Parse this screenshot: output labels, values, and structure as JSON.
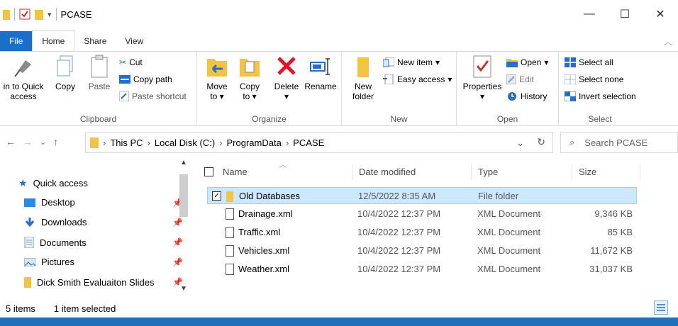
{
  "window": {
    "title": "PCASE",
    "minimize": "—",
    "maximize": "☐",
    "close": "✕"
  },
  "ribbon_tabs": [
    "File",
    "Home",
    "Share",
    "View"
  ],
  "ribbon": {
    "clipboard": {
      "label": "Clipboard",
      "pin_line1": "in to Quick",
      "pin_line2": "access",
      "copy": "Copy",
      "paste": "Paste",
      "cut": "Cut",
      "copy_path": "Copy path",
      "paste_shortcut": "Paste shortcut"
    },
    "organize": {
      "label": "Organize",
      "move_to_line1": "Move",
      "move_to_line2": "to",
      "copy_to_line1": "Copy",
      "copy_to_line2": "to",
      "delete": "Delete",
      "rename": "Rename"
    },
    "new": {
      "label": "New",
      "new_folder_line1": "New",
      "new_folder_line2": "folder",
      "new_item": "New item",
      "easy_access": "Easy access"
    },
    "open": {
      "label": "Open",
      "properties": "Properties",
      "open": "Open",
      "edit": "Edit",
      "history": "History"
    },
    "select": {
      "label": "Select",
      "select_all": "Select all",
      "select_none": "Select none",
      "invert_selection": "Invert selection"
    }
  },
  "address": {
    "crumbs": [
      "This PC",
      "Local Disk (C:)",
      "ProgramData",
      "PCASE"
    ],
    "search_placeholder": "Search PCASE"
  },
  "nav_pane": {
    "quick_access": "Quick access",
    "items": [
      {
        "label": "Desktop",
        "icon": "desktop-icon"
      },
      {
        "label": "Downloads",
        "icon": "download-arrow-icon"
      },
      {
        "label": "Documents",
        "icon": "document-icon"
      },
      {
        "label": "Pictures",
        "icon": "pictures-icon"
      },
      {
        "label": "Dick Smith Evaluaiton Slides",
        "icon": "folder-icon"
      }
    ]
  },
  "columns": {
    "name": "Name",
    "date": "Date modified",
    "type": "Type",
    "size": "Size"
  },
  "files": [
    {
      "name": "Old Databases",
      "date": "12/5/2022 8:35 AM",
      "type": "File folder",
      "size": "",
      "selected": true
    },
    {
      "name": "Drainage.xml",
      "date": "10/4/2022 12:37 PM",
      "type": "XML Document",
      "size": "9,346 KB"
    },
    {
      "name": "Traffic.xml",
      "date": "10/4/2022 12:37 PM",
      "type": "XML Document",
      "size": "85 KB"
    },
    {
      "name": "Vehicles.xml",
      "date": "10/4/2022 12:37 PM",
      "type": "XML Document",
      "size": "11,672 KB"
    },
    {
      "name": "Weather.xml",
      "date": "10/4/2022 12:37 PM",
      "type": "XML Document",
      "size": "31,037 KB"
    }
  ],
  "status": {
    "item_count": "5 items",
    "selection": "1 item selected"
  },
  "colors": {
    "accent": "#1a6fc9",
    "selection_bg": "#cce8ff",
    "folder": "#f5c342",
    "delete_red": "#e81123"
  }
}
